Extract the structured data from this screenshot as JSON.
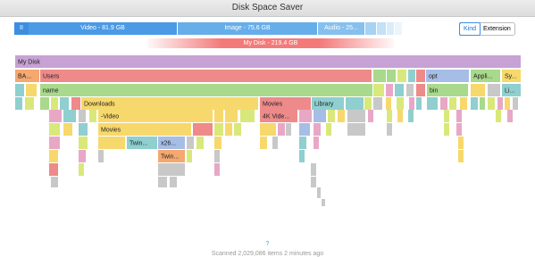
{
  "window": {
    "title": "Disk Space Saver"
  },
  "category_bar": {
    "pause_icon_label": "II",
    "segments": [
      {
        "label": "Video - 81.9 GB",
        "color": "#4a9ae6"
      },
      {
        "label": "Image - 75.6 GB",
        "color": "#66aee9"
      },
      {
        "label": "Audio - 25...",
        "color": "#86c0ee"
      }
    ],
    "tail_colors": [
      "#a6d2f3",
      "#c3e1f7",
      "#d9ecfa",
      "#ecf5fc"
    ]
  },
  "view_toggle": {
    "options": [
      "Kind",
      "Extension"
    ],
    "selected": "Kind"
  },
  "disk_summary": {
    "label": "My Disk - 219.4 GB"
  },
  "treemap": {
    "labels": [
      "My Disk",
      "BA...",
      "Users",
      "opt",
      "Appli...",
      "Sy...",
      "name",
      "bin",
      "Li...",
      "Downloads",
      "Movies",
      "Library",
      "-Video",
      "4K Vide...",
      "Movies",
      "Twin...",
      "x26...",
      "Twin..."
    ]
  },
  "colors": {
    "purple": "#c7a2d4",
    "red": "#ee8a8a",
    "green": "#a9d98c",
    "yellow": "#f7d86c",
    "orange": "#f5a870",
    "teal": "#8fcfcf",
    "blue": "#a6bde6",
    "gray": "#c8c8c8",
    "pink": "#e9a7c6",
    "lime": "#d9e87a"
  },
  "footer": {
    "help": "?",
    "status": "Scanned 2,029,086 items 2 minutes ago"
  }
}
